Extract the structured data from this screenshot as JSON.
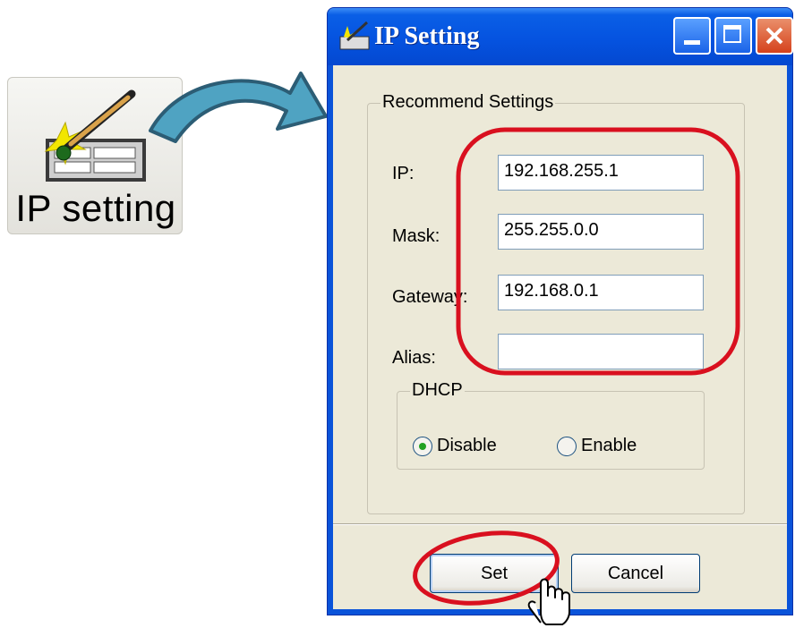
{
  "launcher": {
    "label": "IP setting",
    "icon": "ip-setting-tool-icon"
  },
  "dialog": {
    "title": "IP Setting",
    "title_icon": "network-tool-icon",
    "group_title": "Recommend Settings",
    "fields": {
      "ip": {
        "label": "IP:",
        "value": "192.168.255.1"
      },
      "mask": {
        "label": "Mask:",
        "value": "255.255.0.0"
      },
      "gateway": {
        "label": "Gateway:",
        "value": "192.168.0.1"
      },
      "alias": {
        "label": "Alias:",
        "value": ""
      }
    },
    "dhcp": {
      "title": "DHCP",
      "options": [
        "Disable",
        "Enable"
      ],
      "selected": "Disable"
    },
    "buttons": {
      "set": "Set",
      "cancel": "Cancel"
    }
  },
  "colors": {
    "titlebar": "#0553e0",
    "highlight": "#d9101f",
    "arrow": "#4fa3c2",
    "dialog_bg": "#ece9d8"
  }
}
